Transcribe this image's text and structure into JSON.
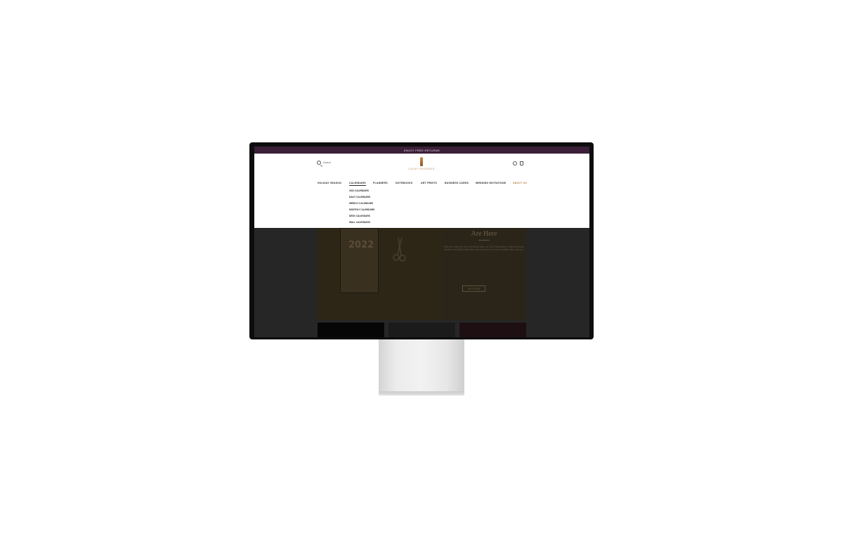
{
  "announcement": "Enjoy free returns",
  "search": {
    "label": "Search"
  },
  "logo": {
    "text": "Lucky Rosebud"
  },
  "nav": [
    {
      "label": "Holiday Season"
    },
    {
      "label": "Calendars"
    },
    {
      "label": "Planners"
    },
    {
      "label": "Notebooks"
    },
    {
      "label": "Art Prints"
    },
    {
      "label": "Business Cards"
    },
    {
      "label": "Wedding Invitations"
    },
    {
      "label": "About Us"
    }
  ],
  "dropdown": [
    {
      "label": "2022 Calendars"
    },
    {
      "label": "Daily Calendars"
    },
    {
      "label": "Weekly Calendars"
    },
    {
      "label": "Monthly Calendars"
    },
    {
      "label": "Desk Calendars"
    },
    {
      "label": "Wall Calendars"
    }
  ],
  "hero": {
    "year": "2022",
    "title": "Are Here",
    "body": "Plan your days for the year ahead with our 2022 Bestsellers, multi-functional, durable and stylish calendars and planners to create beautiful days with you.",
    "button": "Shop now"
  },
  "colors": {
    "announce_bar": "#3b1f38",
    "accent": "#b9874d",
    "overlay": "#262626"
  }
}
